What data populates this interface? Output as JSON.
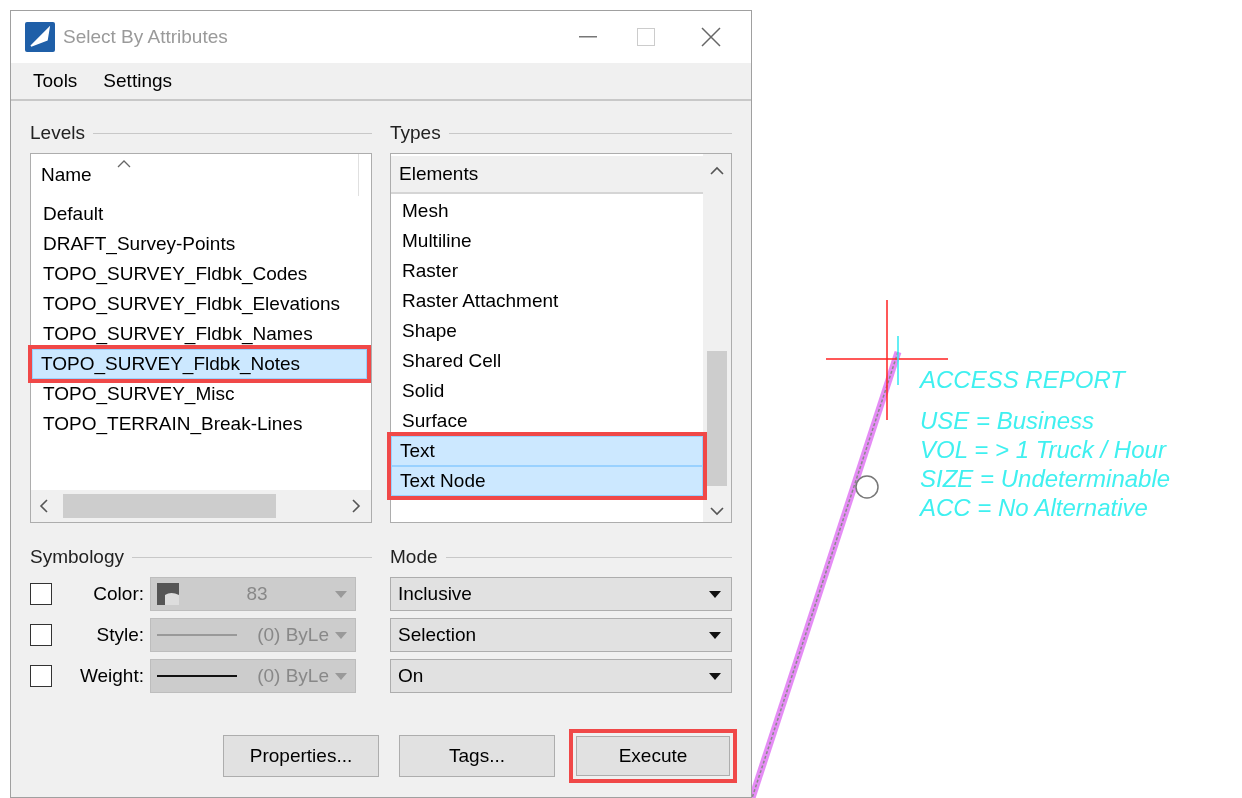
{
  "window": {
    "title": "Select By Attributes"
  },
  "menu": [
    {
      "label": "Tools"
    },
    {
      "label": "Settings"
    }
  ],
  "levels": {
    "title": "Levels",
    "column": "Name",
    "items": [
      {
        "label": "Default",
        "selected": false,
        "highlighted": false
      },
      {
        "label": "DRAFT_Survey-Points",
        "selected": false,
        "highlighted": false
      },
      {
        "label": "TOPO_SURVEY_Fldbk_Codes",
        "selected": false,
        "highlighted": false
      },
      {
        "label": "TOPO_SURVEY_Fldbk_Elevations",
        "selected": false,
        "highlighted": false
      },
      {
        "label": "TOPO_SURVEY_Fldbk_Names",
        "selected": false,
        "highlighted": false
      },
      {
        "label": "TOPO_SURVEY_Fldbk_Notes",
        "selected": true,
        "highlighted": true
      },
      {
        "label": "TOPO_SURVEY_Misc",
        "selected": false,
        "highlighted": false
      },
      {
        "label": "TOPO_TERRAIN_Break-Lines",
        "selected": false,
        "highlighted": false
      }
    ]
  },
  "types": {
    "title": "Types",
    "column": "Elements",
    "items": [
      {
        "label": "Mesh",
        "selected": false,
        "highlighted": false
      },
      {
        "label": "Multiline",
        "selected": false,
        "highlighted": false
      },
      {
        "label": "Raster",
        "selected": false,
        "highlighted": false
      },
      {
        "label": "Raster Attachment",
        "selected": false,
        "highlighted": false
      },
      {
        "label": "Shape",
        "selected": false,
        "highlighted": false
      },
      {
        "label": "Shared Cell",
        "selected": false,
        "highlighted": false
      },
      {
        "label": "Solid",
        "selected": false,
        "highlighted": false
      },
      {
        "label": "Surface",
        "selected": false,
        "highlighted": false
      },
      {
        "label": "Text",
        "selected": true,
        "highlighted": true
      },
      {
        "label": "Text Node",
        "selected": true,
        "highlighted": true
      }
    ]
  },
  "symbology": {
    "title": "Symbology",
    "rows": [
      {
        "kind": "color",
        "label": "Color:",
        "checked": false,
        "value": "83"
      },
      {
        "kind": "style",
        "label": "Style:",
        "checked": false,
        "value": "(0) ByLe"
      },
      {
        "kind": "weight",
        "label": "Weight:",
        "checked": false,
        "value": "(0) ByLe"
      }
    ]
  },
  "mode": {
    "title": "Mode",
    "dropdowns": [
      {
        "value": "Inclusive"
      },
      {
        "value": "Selection"
      },
      {
        "value": "On"
      }
    ]
  },
  "buttons": [
    {
      "label": "Properties...",
      "highlighted": false
    },
    {
      "label": "Tags...",
      "highlighted": false
    },
    {
      "label": "Execute",
      "highlighted": true
    }
  ],
  "canvas": {
    "note_title": "ACCESS REPORT",
    "note_lines": [
      "USE = Business",
      "VOL = > 1 Truck / Hour",
      "SIZE = Undeterminable",
      "ACC = No Alternative"
    ]
  }
}
